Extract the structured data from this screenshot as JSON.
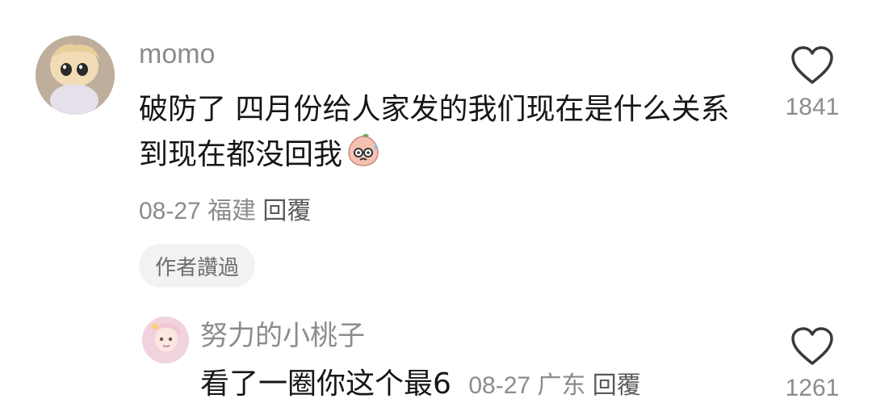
{
  "comment": {
    "avatar": "avatar",
    "username": "momo",
    "text": "破防了 四月份给人家发的我们现在是什么关系到现在都没回我",
    "emoji": "sweat-face-emoji",
    "date": "08-27",
    "location": "福建",
    "reply_label": "回覆",
    "author_liked_label": "作者讚過",
    "likes": "1841"
  },
  "reply": {
    "avatar": "avatar",
    "username": "努力的小桃子",
    "text": "看了一圈你这个最6",
    "date": "08-27",
    "location": "广东",
    "reply_label": "回覆",
    "likes": "1261"
  },
  "colors": {
    "secondary_text": "#8c8c8c",
    "primary_text": "#161616",
    "chip_bg": "#f2f2f2"
  }
}
